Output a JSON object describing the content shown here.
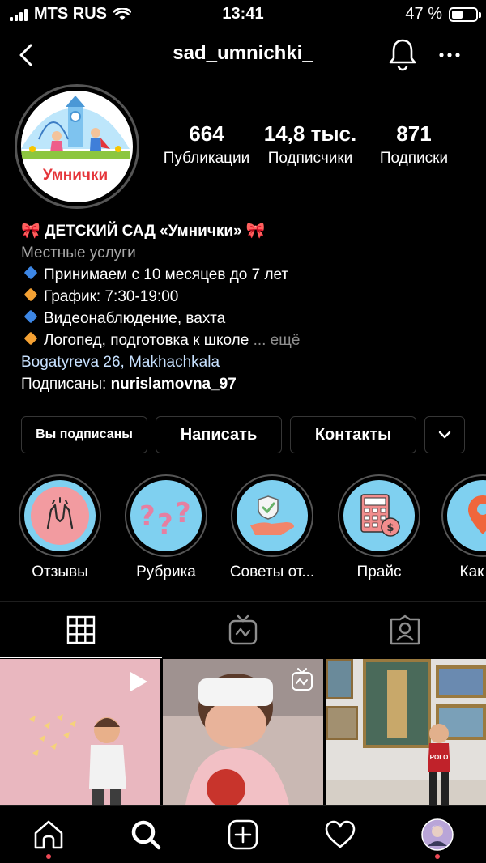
{
  "status_bar": {
    "carrier": "MTS RUS",
    "time": "13:41",
    "battery": "47 %",
    "battery_level": 0.47
  },
  "header": {
    "username": "sad_umnichki_"
  },
  "profile": {
    "avatar_text": "Умнички",
    "stats": [
      {
        "value": "664",
        "label": "Публикации"
      },
      {
        "value": "14,8 тыс.",
        "label": "Подписчики"
      },
      {
        "value": "871",
        "label": "Подписки"
      }
    ],
    "name": "ДЕТСКИЙ САД «Умнички»",
    "category": "Местные услуги",
    "bio_lines": [
      "Принимаем с 10 месяцев до 7 лет",
      "График: 7:30-19:00",
      "Видеонаблюдение, вахта",
      "Логопед, подготовка к школе"
    ],
    "more": "... ещё",
    "location": "Bogatyreva 26, Makhachkala",
    "followed_by_prefix": "Подписаны: ",
    "followed_by_user": "nurislamovna_97"
  },
  "buttons": {
    "following": "Вы подписаны",
    "message": "Написать",
    "contacts": "Контакты"
  },
  "highlights": [
    {
      "label": "Отзывы",
      "icon": "praying-hands-icon"
    },
    {
      "label": "Рубрика",
      "icon": "question-marks-icon"
    },
    {
      "label": "Советы от...",
      "icon": "hand-shield-icon"
    },
    {
      "label": "Прайс",
      "icon": "calculator-icon"
    },
    {
      "label": "Как до",
      "icon": "location-pin-icon"
    }
  ],
  "tabs": [
    "grid-icon",
    "igtv-icon",
    "tagged-icon"
  ],
  "posts": [
    {
      "type": "video"
    },
    {
      "type": "igtv"
    },
    {
      "type": "photo",
      "shirt_text": "POLO"
    }
  ],
  "colors": {
    "accent_blue": "#3d87e6",
    "accent_orange": "#f4a133",
    "notification": "#ed4956",
    "highlight_bg": "#7fd0f0"
  }
}
